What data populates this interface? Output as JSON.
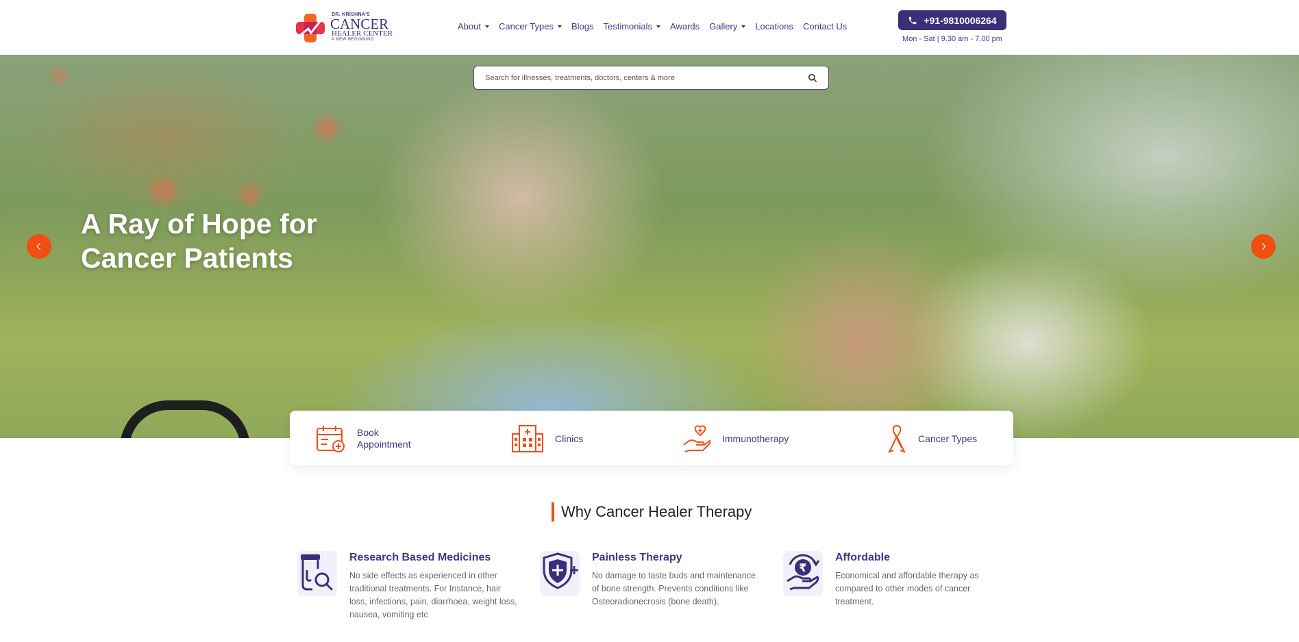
{
  "header": {
    "logo": {
      "small": "DR. KRISHNA'S",
      "big": "CANCER",
      "mid": "HEALER CENTER",
      "tag": "A NEW BEGINNING"
    },
    "nav": [
      {
        "label": "About",
        "dropdown": true
      },
      {
        "label": "Cancer Types",
        "dropdown": true
      },
      {
        "label": "Blogs",
        "dropdown": false
      },
      {
        "label": "Testimonials",
        "dropdown": true
      },
      {
        "label": "Awards",
        "dropdown": false
      },
      {
        "label": "Gallery",
        "dropdown": true
      },
      {
        "label": "Locations",
        "dropdown": false
      },
      {
        "label": "Contact Us",
        "dropdown": false
      }
    ],
    "phone": "+91-9810006264",
    "hours": "Mon - Sat | 9.30 am - 7.00 pm"
  },
  "hero": {
    "search_placeholder": "Search for illnesses, treatments, doctors, centers & more",
    "title_line1": "A Ray of Hope for",
    "title_line2": "Cancer Patients"
  },
  "quick_links": [
    {
      "label_line1": "Book",
      "label_line2": "Appointment",
      "icon": "calendar-plus-icon"
    },
    {
      "label_line1": "Clinics",
      "label_line2": "",
      "icon": "hospital-building-icon"
    },
    {
      "label_line1": "Immunotherapy",
      "label_line2": "",
      "icon": "heart-hand-icon"
    },
    {
      "label_line1": "Cancer Types",
      "label_line2": "",
      "icon": "awareness-ribbon-icon"
    }
  ],
  "why": {
    "title": "Why Cancer Healer Therapy",
    "features": [
      {
        "title": "Research Based Medicines",
        "desc": "No side effects as experienced in other traditional treatments. For Instance, hair loss, infections, pain, diarrhoea, weight loss, nausea, vomiting etc",
        "icon": "medicine-research-icon"
      },
      {
        "title": "Painless Therapy",
        "desc": "No damage to taste buds and maintenance of bone strength. Prevents conditions like Osteoradionecrosis (bone death).",
        "icon": "shield-medical-icon"
      },
      {
        "title": "Affordable",
        "desc": "Economical and affordable therapy as compared to other modes of cancer treatment.",
        "icon": "rupee-hand-icon"
      }
    ]
  },
  "colors": {
    "primary": "#3b2f7a",
    "accent": "#f04e12",
    "nav_text": "#3b3a8a"
  }
}
